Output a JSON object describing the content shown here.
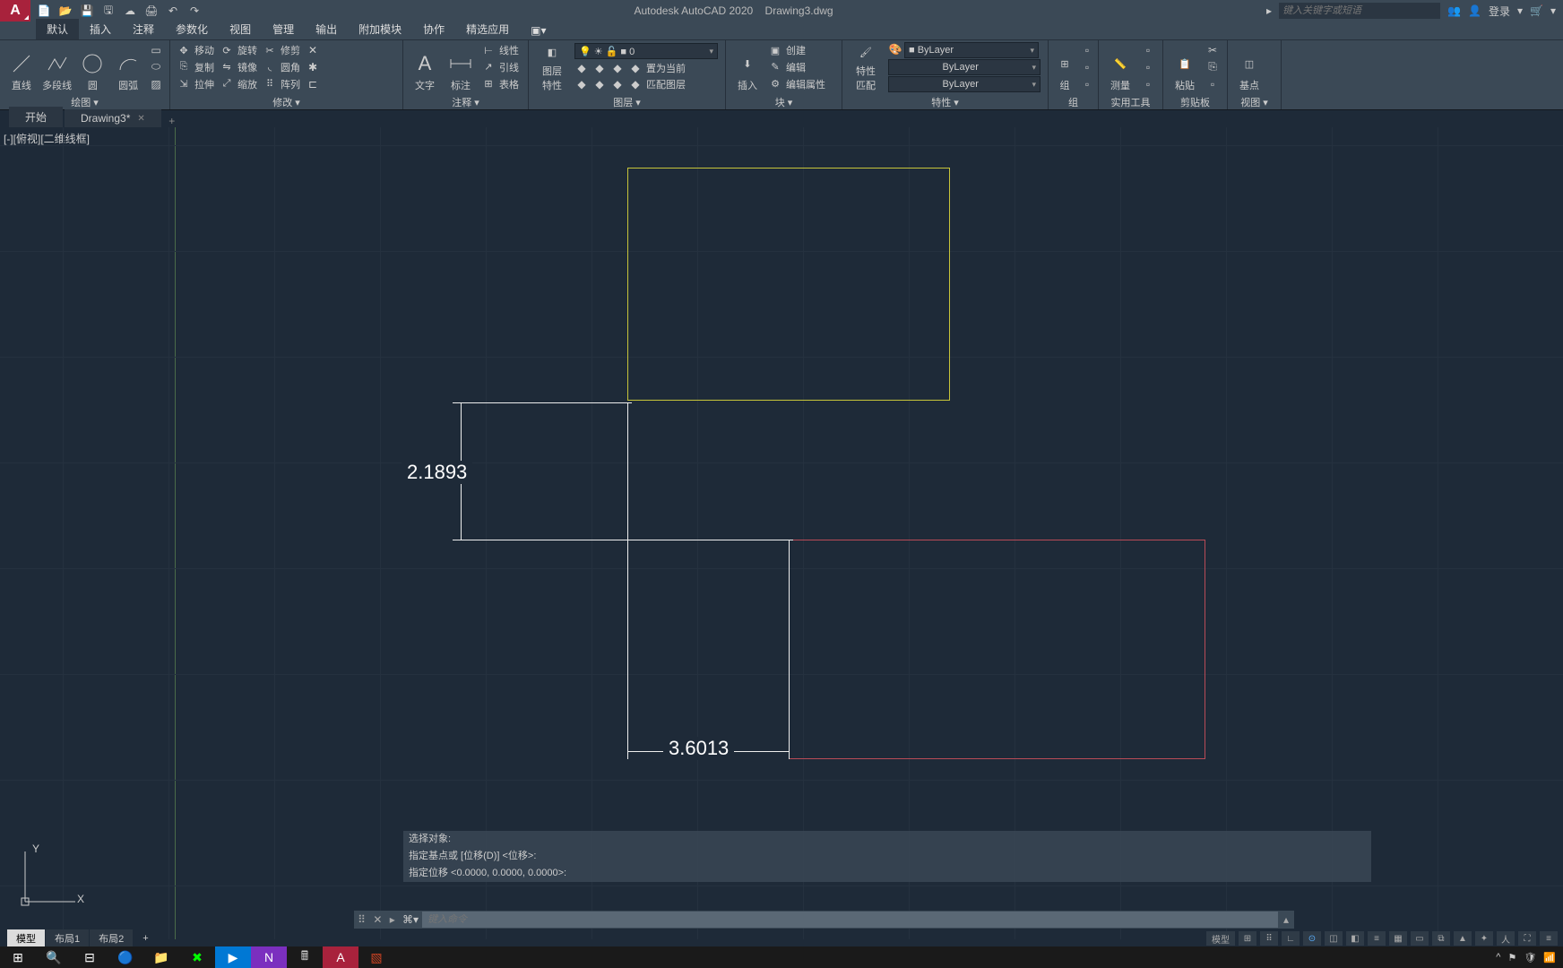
{
  "title": {
    "app": "Autodesk AutoCAD 2020",
    "file": "Drawing3.dwg"
  },
  "search": {
    "placeholder": "键入关键字或短语",
    "login": "登录"
  },
  "menu": [
    "默认",
    "插入",
    "注释",
    "参数化",
    "视图",
    "管理",
    "输出",
    "附加模块",
    "协作",
    "精选应用"
  ],
  "doc_tabs": {
    "start": "开始",
    "current": "Drawing3*"
  },
  "viewport": {
    "label": "[-][俯视][二维线框]",
    "axis_y": "Y",
    "axis_x": "X"
  },
  "layer_sel": "0",
  "bylayer": "ByLayer",
  "ribbon": {
    "draw": {
      "title": "绘图 ▾",
      "line": "直线",
      "polyline": "多段线",
      "circle": "圆",
      "arc": "圆弧"
    },
    "modify": {
      "title": "修改 ▾",
      "move": "移动",
      "copy": "复制",
      "stretch": "拉伸",
      "rotate": "旋转",
      "mirror": "镜像",
      "scale": "缩放",
      "trim": "修剪",
      "fillet": "圆角",
      "array": "阵列"
    },
    "annot": {
      "title": "注释 ▾",
      "text": "文字",
      "dim": "标注",
      "linetype": "线性",
      "leader": "引线",
      "table": "表格"
    },
    "layer": {
      "title": "图层 ▾",
      "name": "图层\n特性",
      "current": "置为当前",
      "match": "匹配图层"
    },
    "block": {
      "title": "块 ▾",
      "insert": "插入",
      "create": "创建",
      "edit": "编辑",
      "attr": "编辑属性"
    },
    "prop": {
      "title": "特性 ▾",
      "match": "特性\n匹配"
    },
    "group": {
      "title": "组",
      "name": "组"
    },
    "util": {
      "title": "实用工具",
      "measure": "测量"
    },
    "clip": {
      "title": "剪贴板",
      "paste": "粘贴"
    },
    "view": {
      "title": "视图 ▾",
      "base": "基点"
    }
  },
  "dimensions": {
    "vertical": "2.1893",
    "horizontal": "3.6013"
  },
  "cmd_history": [
    "选择对象:",
    "指定基点或 [位移(D)] <位移>:",
    "指定位移 <0.0000, 0.0000, 0.0000>:"
  ],
  "cmd_placeholder": "键入命令",
  "layout_tabs": [
    "模型",
    "布局1",
    "布局2"
  ],
  "status_model": "模型"
}
